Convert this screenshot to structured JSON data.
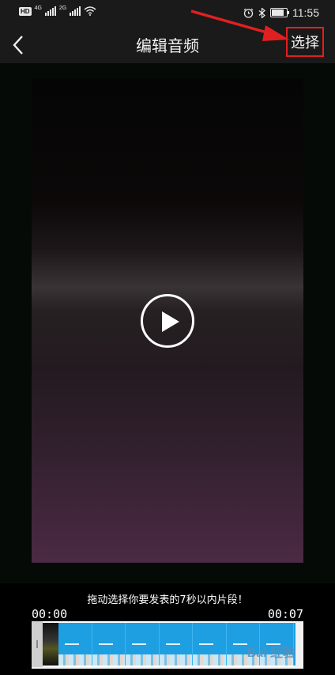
{
  "status_bar": {
    "hd": "HD",
    "sim1": "4G",
    "sim2": "2G",
    "time": "11:55",
    "battery_level": 0.85
  },
  "header": {
    "title": "编辑音频",
    "select_label": "选择",
    "annotation_color": "#e02020"
  },
  "video": {
    "play_icon": "play-icon"
  },
  "bottom": {
    "hint": "拖动选择你要发表的7秒以内片段！",
    "start_time": "00:00",
    "end_time": "00:07"
  },
  "watermark": "Bai 经验"
}
